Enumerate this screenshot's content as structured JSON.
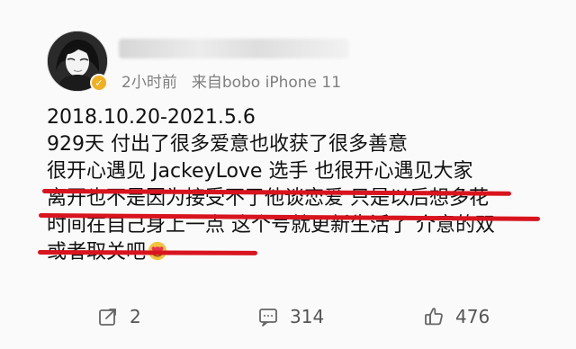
{
  "post": {
    "meta": "2小时前",
    "source": "来自bobo iPhone 11",
    "lines": [
      "2018.10.20-2021.5.6",
      "929天 付出了很多爱意也收获了很多善意",
      "很开心遇见 JackeyLove 选手 也很开心遇见大家",
      "离开也不是因为接受不了他谈恋爱 只是以后想多花",
      "时间在自己身上一点 这个号就更新生活了 介意的双",
      "或者取关吧"
    ]
  },
  "actions": {
    "share_count": "2",
    "comment_count": "314",
    "like_count": "476"
  },
  "icons": {
    "avatar": "avatar-image",
    "verified": "verified-badge-icon",
    "emoji": "heart-eyes-emoji-icon",
    "share": "share-icon",
    "comment": "comment-icon",
    "like": "like-icon"
  },
  "colors": {
    "highlight_red": "#d8141f",
    "verified_gold": "#f0b020"
  }
}
